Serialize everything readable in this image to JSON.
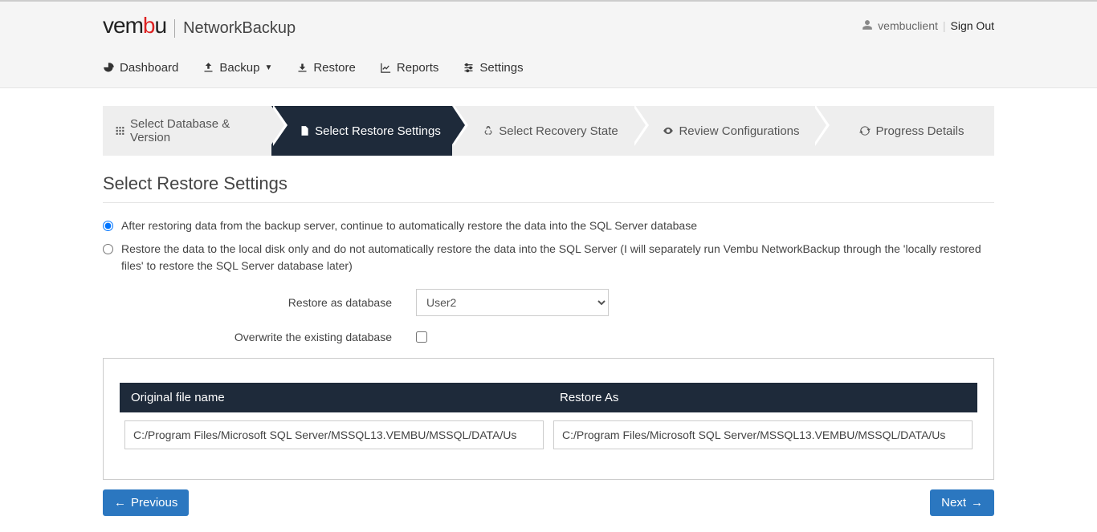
{
  "brand": {
    "product": "NetworkBackup"
  },
  "user": {
    "name": "vembuclient",
    "signout": "Sign Out"
  },
  "nav": {
    "dashboard": "Dashboard",
    "backup": "Backup",
    "restore": "Restore",
    "reports": "Reports",
    "settings": "Settings"
  },
  "steps": {
    "s1": "Select Database & Version",
    "s2": "Select Restore Settings",
    "s3": "Select Recovery State",
    "s4": "Review Configurations",
    "s5": "Progress Details"
  },
  "page": {
    "title": "Select Restore Settings",
    "opt1": "After restoring data from the backup server, continue to automatically restore the data into the SQL Server database",
    "opt2": "Restore the data to the local disk only and do not automatically restore the data into the SQL Server (I will separately run Vembu NetworkBackup through the 'locally restored files' to restore the SQL Server database later)",
    "restore_as_label": "Restore as database",
    "restore_as_value": "User2",
    "overwrite_label": "Overwrite the existing database"
  },
  "table": {
    "col1": "Original file name",
    "col2": "Restore As",
    "rows": [
      {
        "orig": "C:/Program Files/Microsoft SQL Server/MSSQL13.VEMBU/MSSQL/DATA/Us",
        "restore": "C:/Program Files/Microsoft SQL Server/MSSQL13.VEMBU/MSSQL/DATA/Us"
      }
    ]
  },
  "buttons": {
    "prev": "Previous",
    "next": "Next"
  }
}
